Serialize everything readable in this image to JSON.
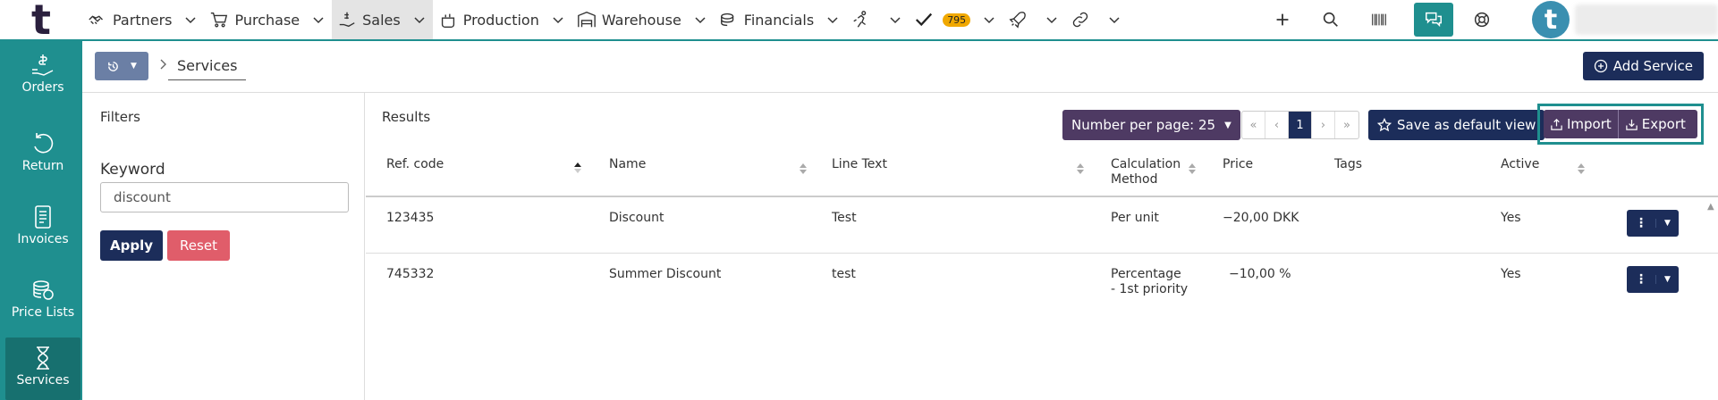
{
  "app": {
    "logo_letter": "t"
  },
  "nav": {
    "items": [
      {
        "label": "Partners",
        "icon": "handshake-icon"
      },
      {
        "label": "Purchase",
        "icon": "cart-icon"
      },
      {
        "label": "Sales",
        "icon": "sales-hand-icon"
      },
      {
        "label": "Production",
        "icon": "pot-icon"
      },
      {
        "label": "Warehouse",
        "icon": "warehouse-icon"
      },
      {
        "label": "Financials",
        "icon": "coins-icon"
      }
    ],
    "tasks_badge": "795",
    "active": "Sales"
  },
  "avatar": {
    "letter": "t"
  },
  "sidebar": {
    "items": [
      {
        "label": "Orders",
        "icon": "money-hand-icon"
      },
      {
        "label": "Return",
        "icon": "undo-icon"
      },
      {
        "label": "Invoices",
        "icon": "invoice-icon"
      },
      {
        "label": "Price Lists",
        "icon": "coins-stack-icon"
      },
      {
        "label": "Services",
        "icon": "hourglass-icon"
      }
    ],
    "active": "Services"
  },
  "breadcrumb": {
    "current": "Services"
  },
  "header": {
    "add_label": "Add Service"
  },
  "filters": {
    "title": "Filters",
    "keyword_label": "Keyword",
    "keyword_value": "discount",
    "apply_label": "Apply",
    "reset_label": "Reset"
  },
  "results": {
    "title": "Results",
    "per_page_label": "Number per page: 25",
    "pager": {
      "first": "«",
      "prev": "‹",
      "current": "1",
      "next": "›",
      "last": "»"
    },
    "save_view_label": "Save as default view",
    "import_label": "Import",
    "export_label": "Export",
    "columns": {
      "ref": "Ref. code",
      "name": "Name",
      "line_text": "Line Text",
      "calc_1": "Calculation",
      "calc_2": "Method",
      "price": "Price",
      "tags": "Tags",
      "active": "Active"
    },
    "rows": [
      {
        "ref": "123435",
        "name": "Discount",
        "line_text": "Test",
        "calc_1": "Per unit",
        "calc_2": "",
        "price": "−20,00 DKK",
        "tags": "",
        "active": "Yes"
      },
      {
        "ref": "745332",
        "name": "Summer Discount",
        "line_text": "test",
        "calc_1": "Percentage",
        "calc_2": "- 1st priority",
        "price": "−10,00 %",
        "tags": "",
        "active": "Yes"
      }
    ]
  },
  "colors": {
    "teal": "#1f8f8f",
    "navy": "#1c2d5a",
    "purple": "#4e3a63",
    "reset_red": "#e05d6a",
    "badge": "#f0a800"
  }
}
